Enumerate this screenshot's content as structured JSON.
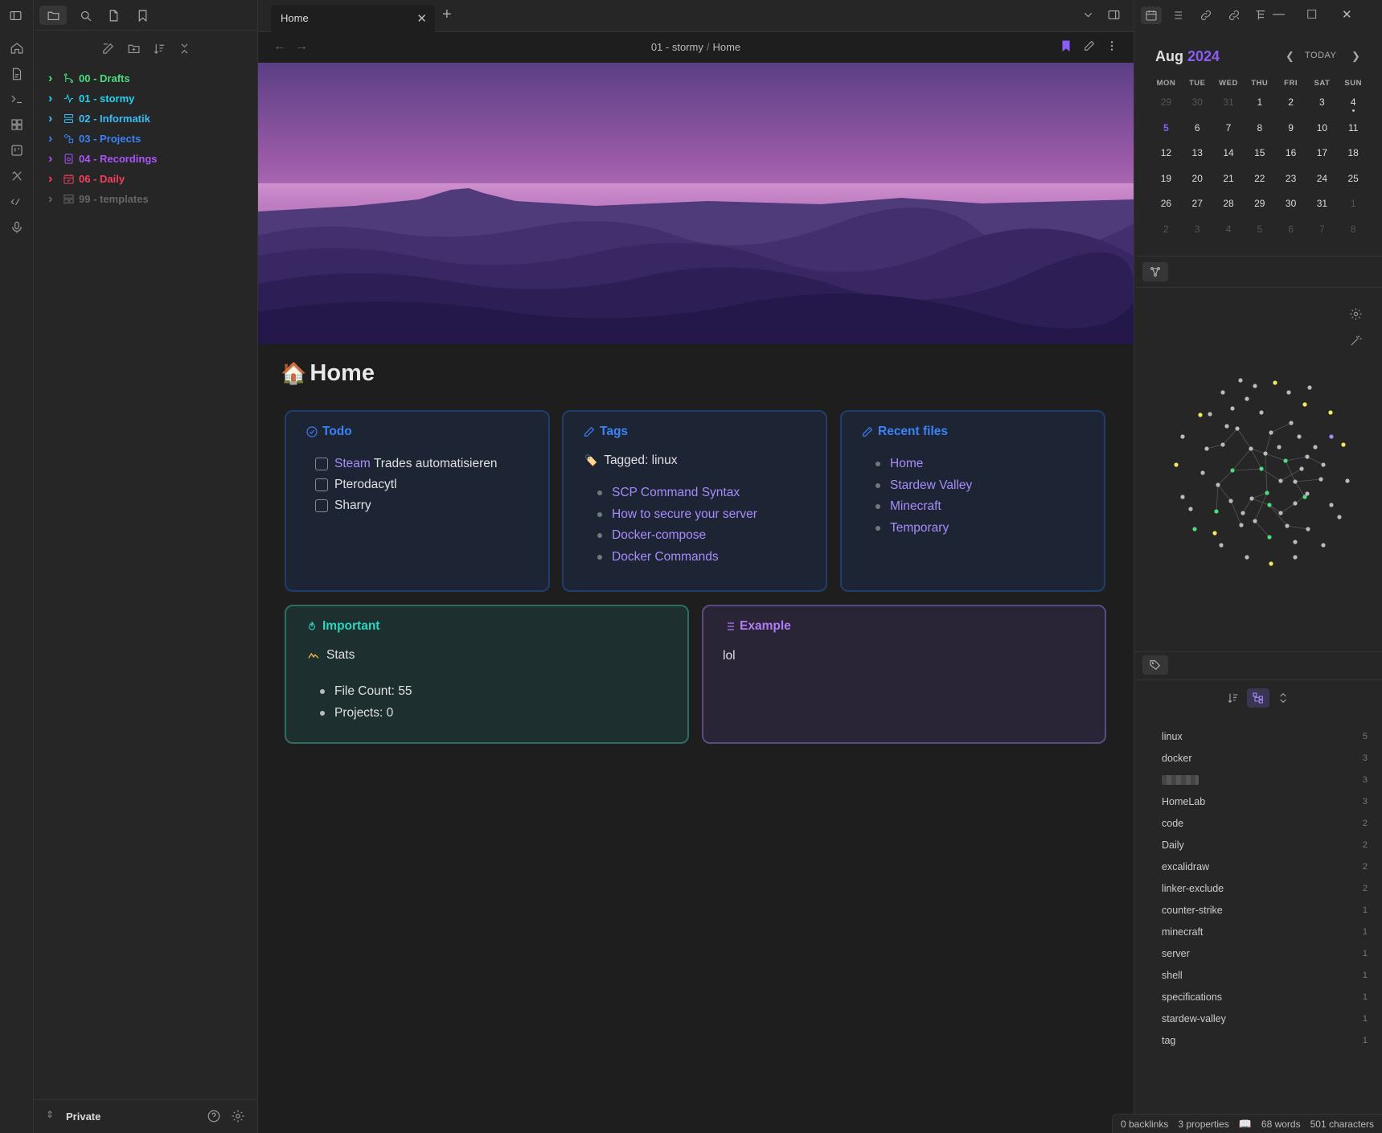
{
  "tab": {
    "title": "Home"
  },
  "breadcrumb": {
    "folder": "01 - stormy",
    "separator": "/",
    "note": "Home"
  },
  "folders": [
    {
      "label": "00 - Drafts",
      "color": "#4ade80",
      "icon": "git-branch-icon"
    },
    {
      "label": "01 - stormy",
      "color": "#22d3ee",
      "icon": "activity-icon"
    },
    {
      "label": "02 - Informatik",
      "color": "#38bdf8",
      "icon": "server-icon"
    },
    {
      "label": "03 - Projects",
      "color": "#3b82f6",
      "icon": "shapes-icon"
    },
    {
      "label": "04 - Recordings",
      "color": "#a855f7",
      "icon": "recording-icon"
    },
    {
      "label": "06 - Daily",
      "color": "#f43f5e",
      "icon": "calendar-icon"
    },
    {
      "label": "99 - templates",
      "color": "#666666",
      "icon": "template-icon"
    }
  ],
  "vault": {
    "name": "Private"
  },
  "note": {
    "title": "Home",
    "emoji": "🏠"
  },
  "todo": {
    "heading": "Todo",
    "items": [
      {
        "link": "Steam",
        "text": " Trades automatisieren"
      },
      {
        "link": "",
        "text": "Pterodacytl"
      },
      {
        "link": "",
        "text": "Sharry"
      }
    ]
  },
  "tags_card": {
    "heading": "Tags",
    "tagged_label": "Tagged: linux",
    "items": [
      "SCP Command Syntax",
      "How to secure your server",
      "Docker-compose",
      "Docker Commands"
    ]
  },
  "recent": {
    "heading": "Recent files",
    "items": [
      "Home",
      "Stardew Valley",
      "Minecraft",
      "Temporary"
    ]
  },
  "important": {
    "heading": "Important",
    "stats_label": "Stats",
    "items": [
      "File Count: 55",
      "Projects: 0"
    ]
  },
  "example": {
    "heading": "Example",
    "body": "lol"
  },
  "calendar": {
    "month": "Aug",
    "year": "2024",
    "today_label": "TODAY",
    "weekdays": [
      "MON",
      "TUE",
      "WED",
      "THU",
      "FRI",
      "SAT",
      "SUN"
    ],
    "weeks": [
      [
        "29",
        "30",
        "31",
        "1",
        "2",
        "3",
        "4"
      ],
      [
        "5",
        "6",
        "7",
        "8",
        "9",
        "10",
        "11"
      ],
      [
        "12",
        "13",
        "14",
        "15",
        "16",
        "17",
        "18"
      ],
      [
        "19",
        "20",
        "21",
        "22",
        "23",
        "24",
        "25"
      ],
      [
        "26",
        "27",
        "28",
        "29",
        "30",
        "31",
        "1"
      ],
      [
        "2",
        "3",
        "4",
        "5",
        "6",
        "7",
        "8"
      ]
    ]
  },
  "tag_pane": {
    "tags": [
      {
        "name": "linux",
        "count": "5"
      },
      {
        "name": "docker",
        "count": "3"
      },
      {
        "name": "",
        "count": "3",
        "redacted": true
      },
      {
        "name": "HomeLab",
        "count": "3"
      },
      {
        "name": "code",
        "count": "2"
      },
      {
        "name": "Daily",
        "count": "2"
      },
      {
        "name": "excalidraw",
        "count": "2"
      },
      {
        "name": "linker-exclude",
        "count": "2"
      },
      {
        "name": "counter-strike",
        "count": "1"
      },
      {
        "name": "minecraft",
        "count": "1"
      },
      {
        "name": "server",
        "count": "1"
      },
      {
        "name": "shell",
        "count": "1"
      },
      {
        "name": "specifications",
        "count": "1"
      },
      {
        "name": "stardew-valley",
        "count": "1"
      },
      {
        "name": "tag",
        "count": "1"
      }
    ]
  },
  "status": {
    "backlinks": "0 backlinks",
    "properties": "3 properties",
    "words": "68 words",
    "characters": "501 characters"
  },
  "colors": {
    "accent": "#8b5cf6",
    "link": "#a78bfa",
    "blue_card": "#3b82f6",
    "teal_card": "#2dd4bf"
  }
}
